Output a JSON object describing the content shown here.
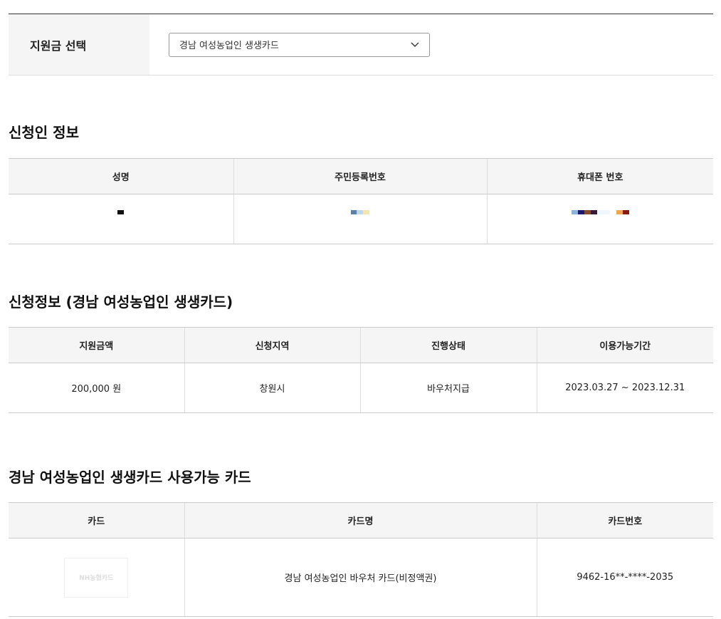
{
  "subsidy_select": {
    "label": "지원금 선택",
    "selected": "경남 여성농업인 생생카드"
  },
  "applicant": {
    "title": "신청인 정보",
    "headers": [
      "성명",
      "주민등록번호",
      "휴대폰 번호"
    ]
  },
  "application": {
    "title": "신청정보 (경남 여성농업인 생생카드)",
    "headers": [
      "지원금액",
      "신청지역",
      "진행상태",
      "이용가능기간"
    ],
    "row": {
      "amount": "200,000 원",
      "region": "창원시",
      "status": "바우처지급",
      "period": "2023.03.27 ~ 2023.12.31"
    },
    "period_color": "#e4352a"
  },
  "cards": {
    "title": "경남 여성농업인 생생카드 사용가능 카드",
    "headers": [
      "카드",
      "카드명",
      "카드번호"
    ],
    "row": {
      "logo_text": "NH농협카드",
      "name": "경남 여성농업인 바우처 카드(비정액권)",
      "number": "9462-16**-****-2035"
    }
  }
}
